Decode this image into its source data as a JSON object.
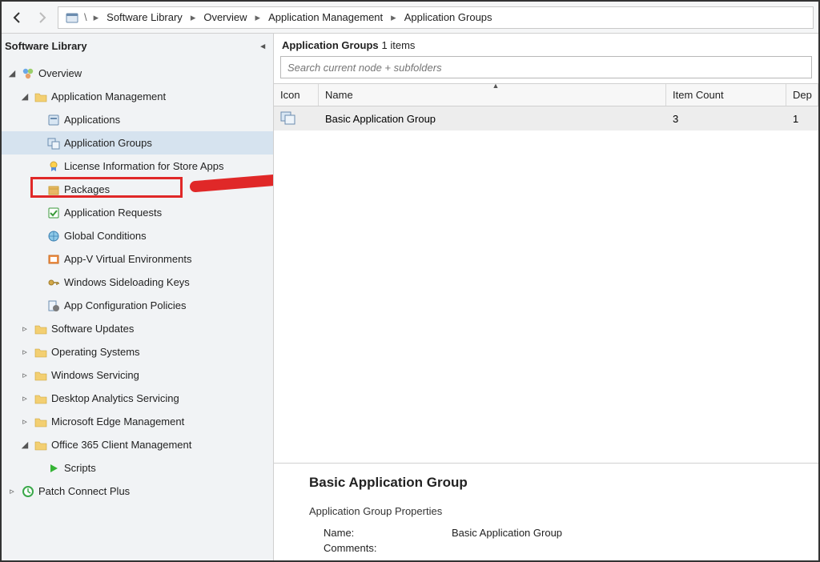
{
  "breadcrumb": {
    "items": [
      "Software Library",
      "Overview",
      "Application Management",
      "Application Groups"
    ]
  },
  "sidebar": {
    "title": "Software Library",
    "overview": "Overview",
    "appmgmt": "Application Management",
    "items": {
      "applications": "Applications",
      "app_groups": "Application Groups",
      "license_info": "License Information for Store Apps",
      "packages": "Packages",
      "app_requests": "Application Requests",
      "global_conditions": "Global Conditions",
      "appv": "App-V Virtual Environments",
      "sideloading": "Windows Sideloading Keys",
      "app_config": "App Configuration Policies"
    },
    "folders": {
      "sw_updates": "Software Updates",
      "os": "Operating Systems",
      "win_servicing": "Windows Servicing",
      "desk_analytics": "Desktop Analytics Servicing",
      "edge": "Microsoft Edge Management",
      "o365": "Office 365 Client Management",
      "scripts": "Scripts",
      "patch": "Patch Connect Plus"
    }
  },
  "main": {
    "title": "Application Groups",
    "count_suffix": "1 items",
    "search_placeholder": "Search current node + subfolders",
    "columns": {
      "icon": "Icon",
      "name": "Name",
      "item_count": "Item Count",
      "dep": "Dep"
    },
    "rows": [
      {
        "name": "Basic Application Group",
        "item_count": "3",
        "dep": "1"
      }
    ]
  },
  "detail": {
    "heading": "Basic Application Group",
    "section": "Application Group Properties",
    "name_label": "Name:",
    "name_value": "Basic Application Group",
    "comments_label": "Comments:"
  }
}
